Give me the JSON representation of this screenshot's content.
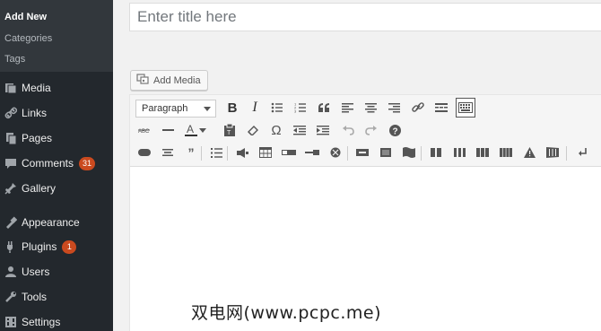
{
  "sidebar": {
    "submenu": [
      {
        "label": "Add New"
      },
      {
        "label": "Categories"
      },
      {
        "label": "Tags"
      }
    ],
    "menu": [
      {
        "label": "Media",
        "icon": "media-icon"
      },
      {
        "label": "Links",
        "icon": "links-icon"
      },
      {
        "label": "Pages",
        "icon": "pages-icon"
      },
      {
        "label": "Comments",
        "icon": "comments-icon",
        "badge": "31"
      },
      {
        "label": "Gallery",
        "icon": "gallery-icon"
      },
      {
        "label": "Appearance",
        "icon": "appearance-icon"
      },
      {
        "label": "Plugins",
        "icon": "plugins-icon",
        "badge": "1"
      },
      {
        "label": "Users",
        "icon": "users-icon"
      },
      {
        "label": "Tools",
        "icon": "tools-icon"
      },
      {
        "label": "Settings",
        "icon": "settings-icon"
      }
    ]
  },
  "editor": {
    "title_placeholder": "Enter title here",
    "add_media_label": "Add Media",
    "format_select_value": "Paragraph",
    "format_select_options": [
      "Paragraph"
    ]
  },
  "watermark": "双电网(www.pcpc.me)",
  "colors": {
    "sidebar_bg": "#23282d",
    "submenu_bg": "#32373c",
    "badge": "#ca4a1f"
  }
}
